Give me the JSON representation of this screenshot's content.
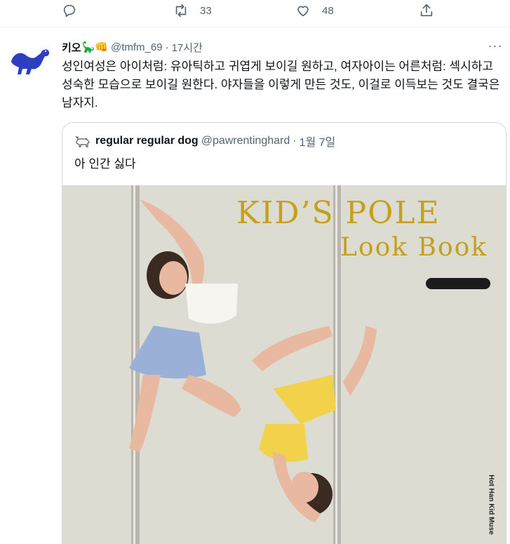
{
  "actions": {
    "reply": {
      "icon": "reply-icon"
    },
    "retweet": {
      "icon": "retweet-icon",
      "count": "33"
    },
    "like": {
      "icon": "like-icon",
      "count": "48"
    },
    "share": {
      "icon": "share-icon"
    }
  },
  "tweet": {
    "name": "키오🦕👊",
    "name_text": "키오",
    "emoji": "🦕👊",
    "handle": "@tmfm_69",
    "dot": "·",
    "time": "17시간",
    "more": "···",
    "text": "성인여성은 아이처럼: 유아틱하고 귀엽게 보이길 원하고, 여자아이는 어른처럼: 섹시하고 성숙한 모습으로 보이길 원한다. 야자들을 이렇게 만든 것도, 이걸로 이득보는 것도 결국은 남자지."
  },
  "quote": {
    "name": "regular regular dog",
    "handle": "@pawrentinghard",
    "dot": "·",
    "time": "1월 7일",
    "text": "아 인간 싫다",
    "media": {
      "title_line1": "KID’S POLE",
      "title_line2": "Look Book",
      "watermark": "Hot Han Kid Muse"
    }
  },
  "colors": {
    "text": "#0f1419",
    "muted": "#536471",
    "border": "#cfd9de",
    "title_gold": "#c5a01f",
    "media_bg": "#dcdcd2"
  }
}
